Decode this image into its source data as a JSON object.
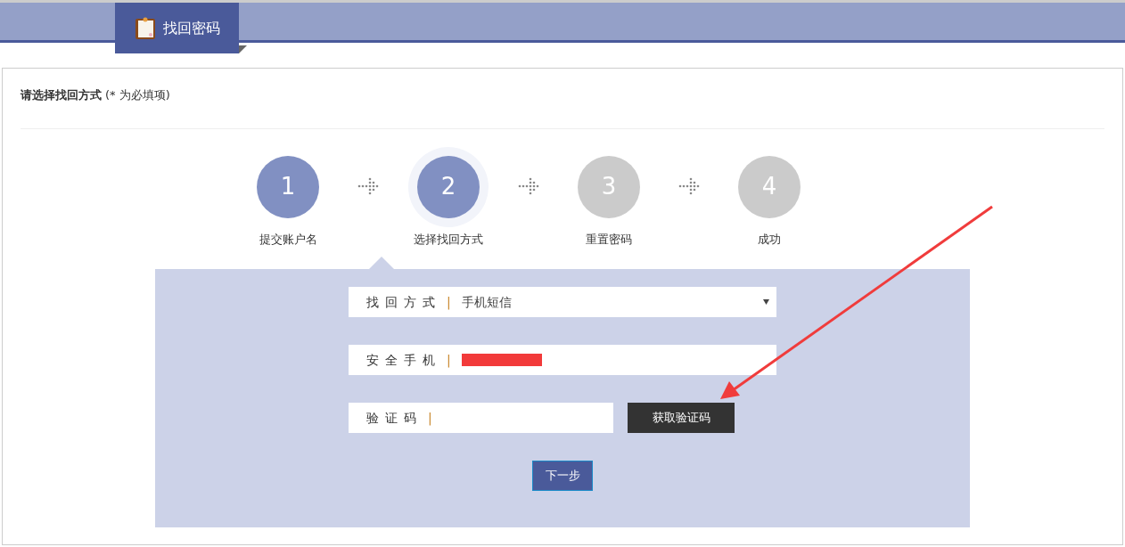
{
  "header": {
    "tab_title": "找回密码"
  },
  "form_heading": {
    "title": "请选择找回方式",
    "note": "(* 为必填项)"
  },
  "steps": [
    {
      "number": "1",
      "label": "提交账户名",
      "completed": true,
      "selected": false
    },
    {
      "number": "2",
      "label": "选择找回方式",
      "completed": true,
      "selected": true
    },
    {
      "number": "3",
      "label": "重置密码",
      "completed": false,
      "selected": false
    },
    {
      "number": "4",
      "label": "成功",
      "completed": false,
      "selected": false
    }
  ],
  "fields": [
    {
      "kind": "select",
      "label": "找回方式",
      "separator": "|",
      "value": "手机短信"
    },
    {
      "kind": "redacted",
      "label": "安全手机",
      "separator": "|"
    },
    {
      "kind": "code",
      "label": "验证码",
      "separator": "|",
      "button": "获取验证码"
    }
  ],
  "next_button": "下一步"
}
